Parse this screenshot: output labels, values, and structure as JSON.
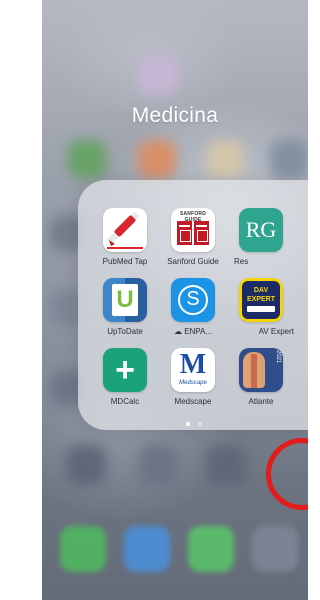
{
  "folder": {
    "title": "Medicina",
    "page_dots": 2,
    "active_page": 0
  },
  "apps": [
    {
      "label": "PubMed Tap",
      "icon": "pubmed-tap-icon",
      "color": "#ffffff",
      "accent": "#d7262c"
    },
    {
      "label": "Sanford Guide",
      "icon": "sanford-guide-icon",
      "color": "#ffffff",
      "accent": "#c41a26",
      "icon_text": "SANFORD GUIDE"
    },
    {
      "label": "Res",
      "icon": "researchgate-icon",
      "color": "#2fa58f",
      "icon_text": "RG"
    },
    {
      "label": "UpToDate",
      "icon": "uptodate-icon",
      "color": "#2b6fb0",
      "accent": "#7dbb42",
      "icon_text": "U"
    },
    {
      "label": "ENPA...",
      "icon": "enpa-icon",
      "color": "#1d93e6",
      "prefix": "☁",
      "icon_text": "S"
    },
    {
      "label": "AV Expert",
      "icon": "dav-expert-icon",
      "color": "#1c2a66",
      "accent": "#f5d500",
      "icon_text": "DAV EXPERT"
    },
    {
      "label": "MDCalc",
      "icon": "mdcalc-icon",
      "color": "#1aa37a",
      "icon_text": "+"
    },
    {
      "label": "Medscape",
      "icon": "medscape-icon",
      "color": "#ffffff",
      "accent": "#1d4fa1",
      "icon_text": "M",
      "icon_subtext": "Medscape"
    },
    {
      "label": "Atlante",
      "icon": "atlante-anatomy-icon",
      "color": "#2f4d8a",
      "accent": "#e0a075",
      "icon_text": "2021"
    }
  ],
  "highlight": {
    "color": "#e21b1b",
    "target": "AV Expert"
  }
}
